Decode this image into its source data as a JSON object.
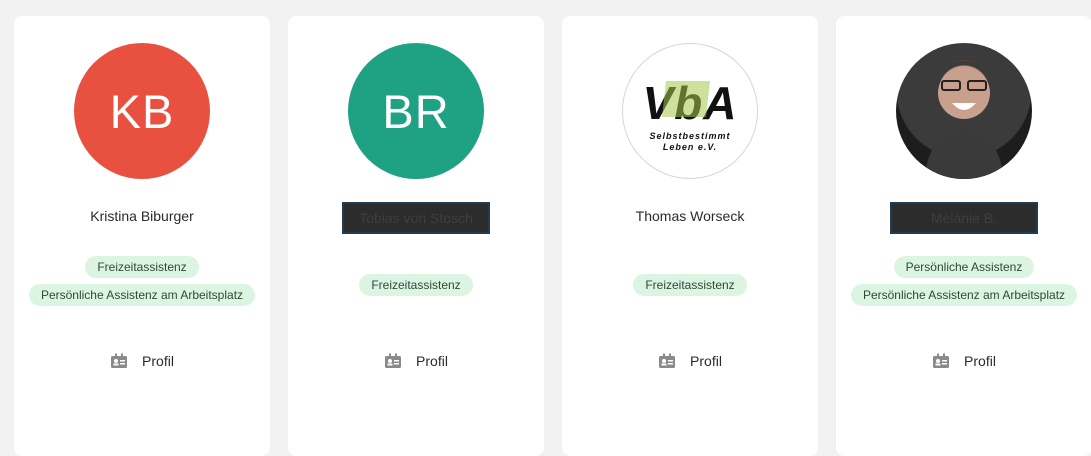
{
  "cards": [
    {
      "avatar_initials": "KB",
      "avatar_color": "#e85140",
      "name": "Kristina Biburger",
      "tags": [
        "Freizeitassistenz",
        "Persönliche Assistenz am Arbeitsplatz"
      ],
      "profile_label": "Profil"
    },
    {
      "avatar_initials": "BR",
      "avatar_color": "#1fa283",
      "name": "Tobias von Stosch",
      "tags": [
        "Freizeitassistenz"
      ],
      "profile_label": "Profil"
    },
    {
      "avatar_logo": {
        "text": "VbA",
        "subtitle_1": "Selbstbestimmt",
        "subtitle_2": "Leben e.V."
      },
      "name": "Thomas Worseck",
      "tags": [
        "Freizeitassistenz"
      ],
      "profile_label": "Profil"
    },
    {
      "avatar_photo": "photo-of-smiling-person",
      "name": "Melanie B.",
      "tags": [
        "Persönliche Assistenz",
        "Persönliche Assistenz am Arbeitsplatz"
      ],
      "profile_label": "Profil"
    }
  ],
  "colors": {
    "tag_bg": "#dcf5e2",
    "page_bg": "#f2f2f2",
    "card_bg": "#ffffff"
  },
  "icons": {
    "profile_icon": "id-card-icon"
  }
}
